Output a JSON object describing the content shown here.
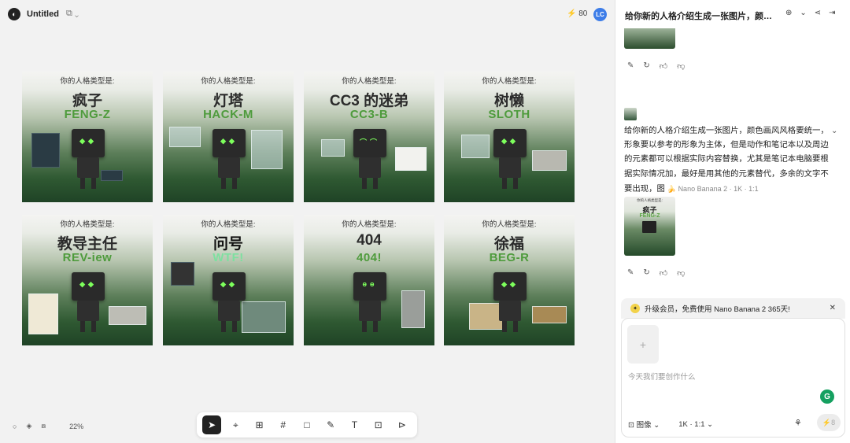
{
  "header": {
    "title": "Untitled",
    "credits": "80",
    "avatar_text": "LC"
  },
  "cards": [
    {
      "caption": "你的人格类型是:",
      "name": "疯子",
      "code": "FENG-Z"
    },
    {
      "caption": "你的人格类型是:",
      "name": "灯塔",
      "code": "HACK-M"
    },
    {
      "caption": "你的人格类型是:",
      "name": "CC3 的迷弟",
      "code": "CC3-B"
    },
    {
      "caption": "你的人格类型是:",
      "name": "树懒",
      "code": "SLOTH"
    },
    {
      "caption": "你的人格类型是:",
      "name": "教导主任",
      "code": "REV-iew"
    },
    {
      "caption": "你的人格类型是:",
      "name": "问号",
      "code": "WTF!"
    },
    {
      "caption": "你的人格类型是:",
      "name": "404",
      "code": "404!"
    },
    {
      "caption": "你的人格类型是:",
      "name": "徐福",
      "code": "BEG-R"
    }
  ],
  "status": {
    "zoom": "22%"
  },
  "panel": {
    "title": "给你新的人格介绍生成一张图片，颜…",
    "message": "给你新的人格介绍生成一张图片，颜色画风风格要统一，形象要以参考的形象为主体，但是动作和笔记本以及周边的元素都可以根据实际内容替换，尤其是笔记本电脑要根据实际情况加，最好是用其他的元素替代，多余的文字不要出现，图",
    "meta": "Nano Banana 2 · 1K · 1:1",
    "thumb": {
      "caption": "你的人格类型是:",
      "name": "疯子",
      "code": "FENG-Z"
    },
    "promo": "升级会员，免费使用 Nano Banana 2 365天!",
    "composer_placeholder": "今天我们要创作什么",
    "image_label": "图像",
    "size_label": "1K · 1:1",
    "send_credits": "8"
  },
  "colors": {
    "accent": "#4e9b3c",
    "avatar": "#3d7de8"
  }
}
